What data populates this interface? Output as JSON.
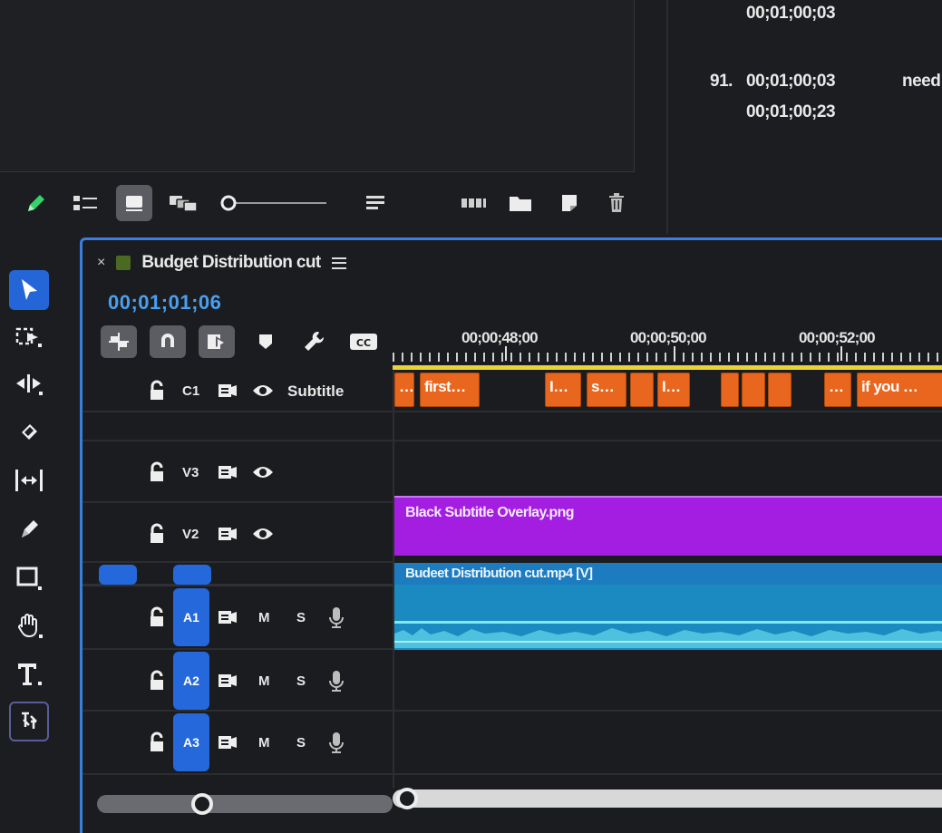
{
  "captions_list": {
    "row1_time": "00;01;00;03",
    "row2_number": "91.",
    "row2_start": "00;01;00;03",
    "row2_text": "need",
    "row2_end": "00;01;00;23"
  },
  "timeline": {
    "title": "Budget Distribution cut",
    "timecode": "00;01;01;06",
    "ruler_labels": [
      "00;00;48;00",
      "00;00;50;00",
      "00;00;52;00"
    ]
  },
  "tracks": {
    "subtitle": {
      "id": "C1",
      "name": "Subtitle"
    },
    "v3": {
      "id": "V3"
    },
    "v2": {
      "id": "V2"
    },
    "a1": {
      "id": "A1",
      "mute": "M",
      "solo": "S"
    },
    "a2": {
      "id": "A2",
      "mute": "M",
      "solo": "S"
    },
    "a3": {
      "id": "A3",
      "mute": "M",
      "solo": "S"
    }
  },
  "clips": {
    "captions": [
      "…",
      "first…",
      "I…",
      "s…",
      "",
      "I…",
      "",
      "",
      "",
      "…",
      "if you …"
    ],
    "v2_clip": "Black Subtitle Overlay.png",
    "v1_clip": "Budeet Distribution cut.mp4 [V]"
  },
  "colors": {
    "accent_blue": "#2468dc",
    "timecode_blue": "#4aa0f0",
    "caption_orange": "#e8661e",
    "graphic_purple": "#a31ee0",
    "video_blue": "#1d7cbf",
    "ruler_yellow": "#e9d437"
  }
}
